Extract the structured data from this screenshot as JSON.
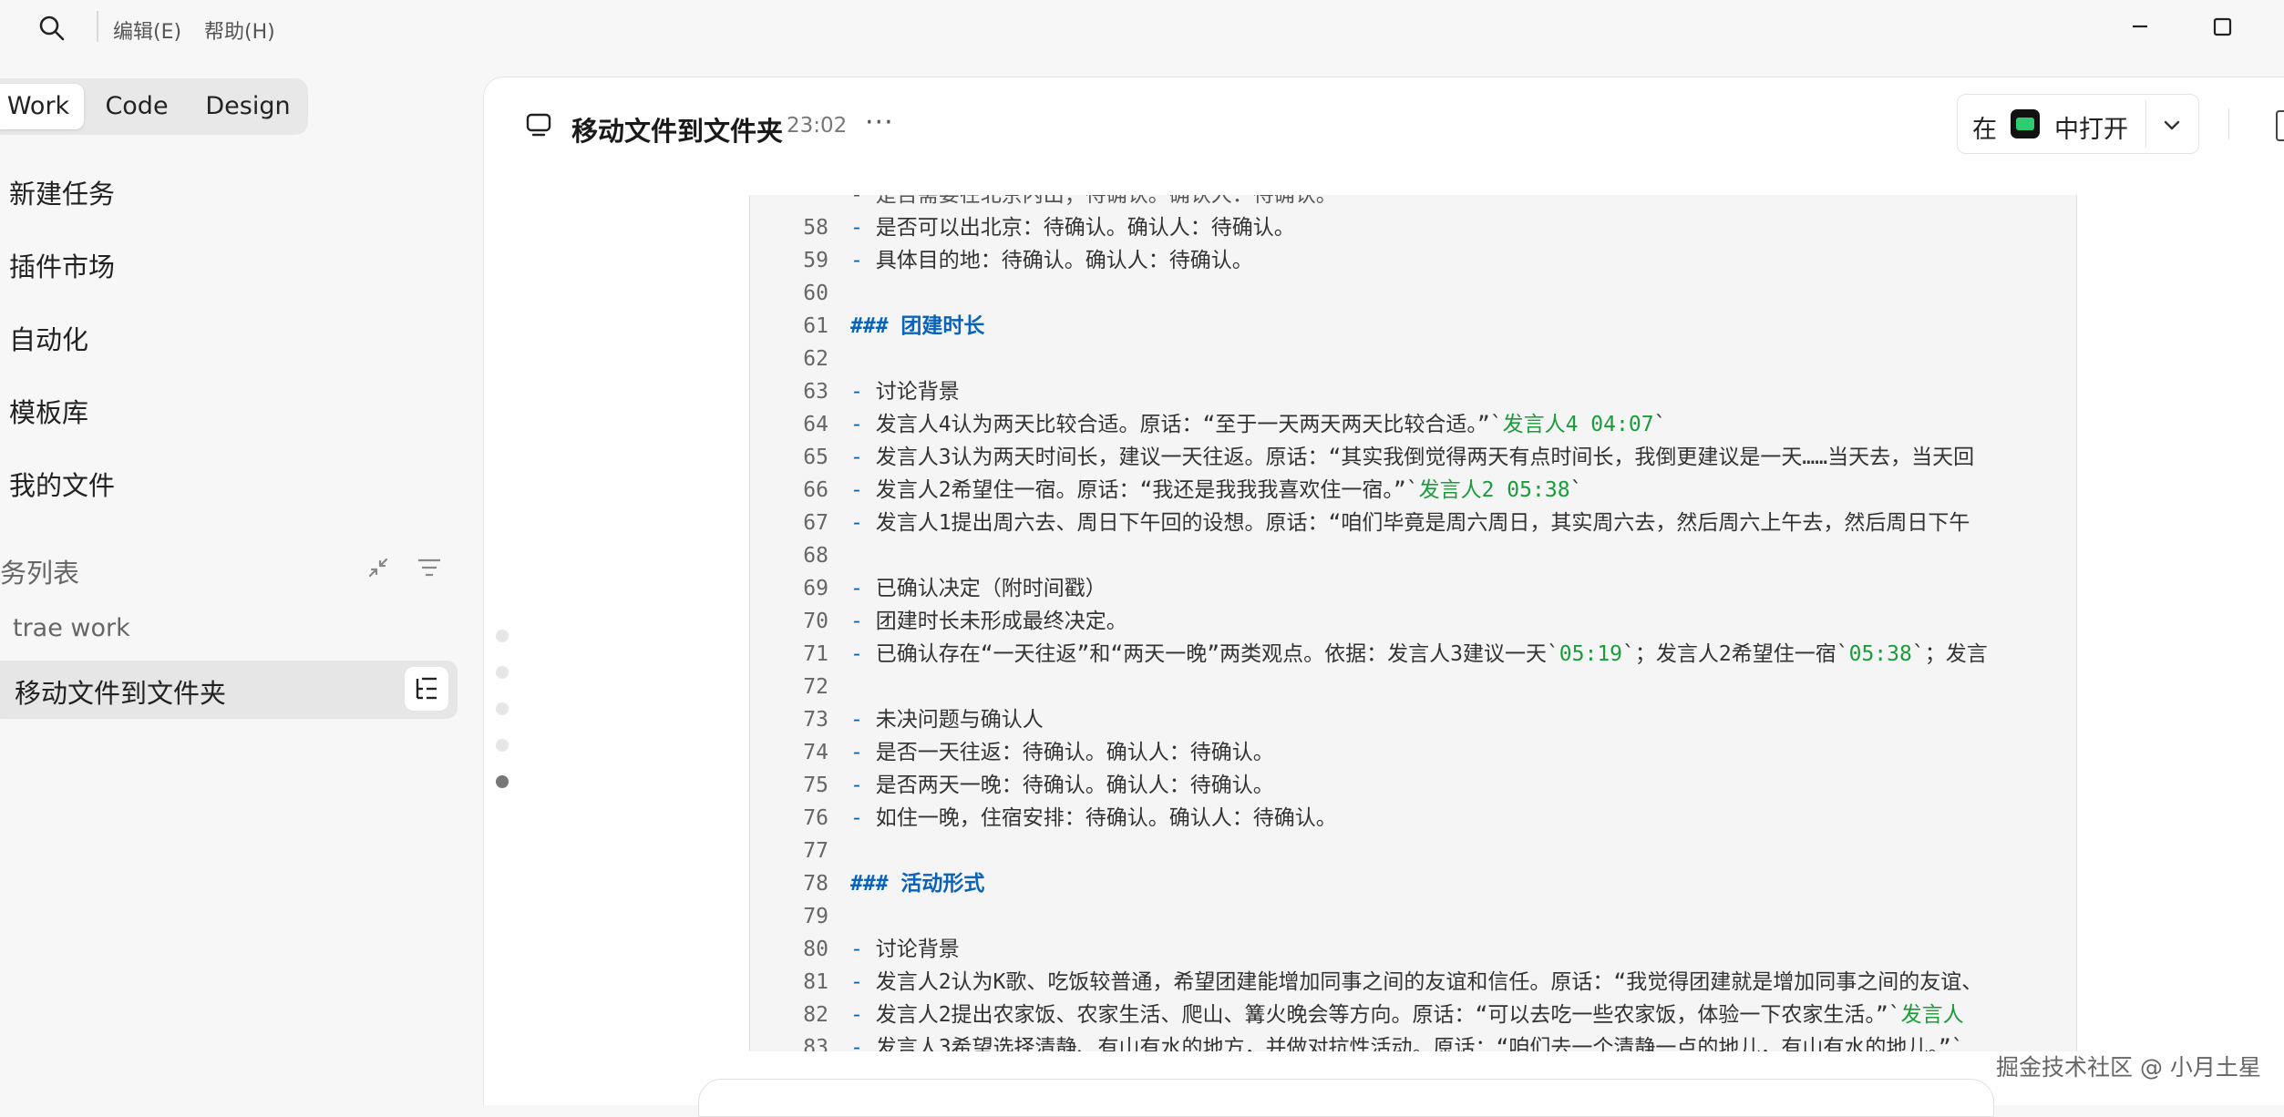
{
  "titlebar": {
    "menu_edit": "编辑(E)",
    "menu_help": "帮助(H)"
  },
  "sidebar": {
    "tabs": [
      {
        "label": "Work",
        "active": true
      },
      {
        "label": "Code",
        "active": false
      },
      {
        "label": "Design",
        "active": false
      }
    ],
    "nav": [
      {
        "label": "新建任务"
      },
      {
        "label": "插件市场"
      },
      {
        "label": "自动化"
      },
      {
        "label": "模板库"
      },
      {
        "label": "我的文件"
      }
    ],
    "section_title": "务列表",
    "group_label": "trae work",
    "task_label": "移动文件到文件夹"
  },
  "header": {
    "title": "移动文件到文件夹",
    "time": "23:02",
    "more": "···",
    "open_in": "在",
    "open_label": "中打开"
  },
  "code": {
    "partial_line": "  - 是否需要在北京内出；待确认。确认人：待确认。",
    "lines": [
      {
        "n": "58",
        "parts": [
          {
            "t": "  ",
            "k": "plain"
          },
          {
            "t": "-",
            "k": "dash"
          },
          {
            "t": " 是否可以出北京：待确认。确认人：待确认。",
            "k": "plain"
          }
        ]
      },
      {
        "n": "59",
        "parts": [
          {
            "t": "  ",
            "k": "plain"
          },
          {
            "t": "-",
            "k": "dash"
          },
          {
            "t": " 具体目的地：待确认。确认人：待确认。",
            "k": "plain"
          }
        ]
      },
      {
        "n": "60",
        "parts": []
      },
      {
        "n": "61",
        "parts": [
          {
            "t": "### 团建时长",
            "k": "hash"
          }
        ]
      },
      {
        "n": "62",
        "parts": []
      },
      {
        "n": "63",
        "parts": [
          {
            "t": "-",
            "k": "dash"
          },
          {
            "t": " 讨论背景",
            "k": "plain"
          }
        ]
      },
      {
        "n": "64",
        "parts": [
          {
            "t": "  ",
            "k": "plain"
          },
          {
            "t": "-",
            "k": "dash"
          },
          {
            "t": " 发言人4认为两天比较合适。原话：“至于一天两天两天比较合适。”`",
            "k": "plain"
          },
          {
            "t": "发言人4 04:07",
            "k": "code"
          },
          {
            "t": "`",
            "k": "plain"
          }
        ]
      },
      {
        "n": "65",
        "parts": [
          {
            "t": "  ",
            "k": "plain"
          },
          {
            "t": "-",
            "k": "dash"
          },
          {
            "t": " 发言人3认为两天时间长，建议一天往返。原话：“其实我倒觉得两天有点时间长，我倒更建议是一天……当天去，当天回",
            "k": "plain"
          }
        ]
      },
      {
        "n": "66",
        "parts": [
          {
            "t": "  ",
            "k": "plain"
          },
          {
            "t": "-",
            "k": "dash"
          },
          {
            "t": " 发言人2希望住一宿。原话：“我还是我我我喜欢住一宿。”`",
            "k": "plain"
          },
          {
            "t": "发言人2 05:38",
            "k": "code"
          },
          {
            "t": "`",
            "k": "plain"
          }
        ]
      },
      {
        "n": "67",
        "parts": [
          {
            "t": "  ",
            "k": "plain"
          },
          {
            "t": "-",
            "k": "dash"
          },
          {
            "t": " 发言人1提出周六去、周日下午回的设想。原话：“咱们毕竟是周六周日，其实周六去，然后周六上午去，然后周日下午",
            "k": "plain"
          }
        ]
      },
      {
        "n": "68",
        "parts": []
      },
      {
        "n": "69",
        "parts": [
          {
            "t": "-",
            "k": "dash"
          },
          {
            "t": " 已确认决定（附时间戳）",
            "k": "plain"
          }
        ]
      },
      {
        "n": "70",
        "parts": [
          {
            "t": "  ",
            "k": "plain"
          },
          {
            "t": "-",
            "k": "dash"
          },
          {
            "t": " 团建时长未形成最终决定。",
            "k": "plain"
          }
        ]
      },
      {
        "n": "71",
        "parts": [
          {
            "t": "  ",
            "k": "plain"
          },
          {
            "t": "-",
            "k": "dash"
          },
          {
            "t": " 已确认存在“一天往返”和“两天一晚”两类观点。依据：发言人3建议一天`",
            "k": "plain"
          },
          {
            "t": "05:19",
            "k": "code"
          },
          {
            "t": "`；发言人2希望住一宿`",
            "k": "plain"
          },
          {
            "t": "05:38",
            "k": "code"
          },
          {
            "t": "`；发言",
            "k": "plain"
          }
        ]
      },
      {
        "n": "72",
        "parts": []
      },
      {
        "n": "73",
        "parts": [
          {
            "t": "-",
            "k": "dash"
          },
          {
            "t": " 未决问题与确认人",
            "k": "plain"
          }
        ]
      },
      {
        "n": "74",
        "parts": [
          {
            "t": "  ",
            "k": "plain"
          },
          {
            "t": "-",
            "k": "dash"
          },
          {
            "t": " 是否一天往返：待确认。确认人：待确认。",
            "k": "plain"
          }
        ]
      },
      {
        "n": "75",
        "parts": [
          {
            "t": "  ",
            "k": "plain"
          },
          {
            "t": "-",
            "k": "dash"
          },
          {
            "t": " 是否两天一晚：待确认。确认人：待确认。",
            "k": "plain"
          }
        ]
      },
      {
        "n": "76",
        "parts": [
          {
            "t": "  ",
            "k": "plain"
          },
          {
            "t": "-",
            "k": "dash"
          },
          {
            "t": " 如住一晚，住宿安排：待确认。确认人：待确认。",
            "k": "plain"
          }
        ]
      },
      {
        "n": "77",
        "parts": []
      },
      {
        "n": "78",
        "parts": [
          {
            "t": "### 活动形式",
            "k": "hash"
          }
        ]
      },
      {
        "n": "79",
        "parts": []
      },
      {
        "n": "80",
        "parts": [
          {
            "t": "-",
            "k": "dash"
          },
          {
            "t": " 讨论背景",
            "k": "plain"
          }
        ]
      },
      {
        "n": "81",
        "parts": [
          {
            "t": "  ",
            "k": "plain"
          },
          {
            "t": "-",
            "k": "dash"
          },
          {
            "t": " 发言人2认为K歌、吃饭较普通，希望团建能增加同事之间的友谊和信任。原话：“我觉得团建就是增加同事之间的友谊、",
            "k": "plain"
          }
        ]
      },
      {
        "n": "82",
        "parts": [
          {
            "t": "  ",
            "k": "plain"
          },
          {
            "t": "-",
            "k": "dash"
          },
          {
            "t": " 发言人2提出农家饭、农家生活、爬山、篝火晚会等方向。原话：“可以去吃一些农家饭，体验一下农家生活。”`",
            "k": "plain"
          },
          {
            "t": "发言人",
            "k": "code"
          }
        ]
      },
      {
        "n": "83",
        "parts": [
          {
            "t": "  ",
            "k": "plain"
          },
          {
            "t": "-",
            "k": "dash"
          },
          {
            "t": " 发言人3希望选择清静、有山有水的地方，并做对抗性活动。原话：“咱们去一个清静一点的地儿，有山有水的地儿。”`",
            "k": "plain"
          }
        ]
      }
    ]
  },
  "watermark": "掘金技术社区 @ 小月土星",
  "colors": {
    "accent_blue": "#0a63b8",
    "code_green": "#1a9c3a",
    "terminal_green": "#2ecc71"
  }
}
